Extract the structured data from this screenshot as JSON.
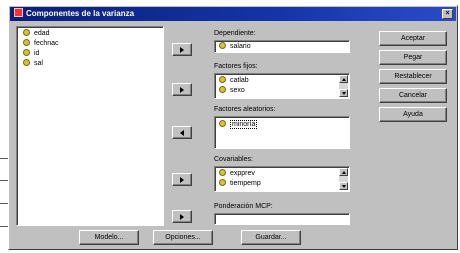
{
  "window": {
    "title": "Componentes de la varianza",
    "close_glyph": "×"
  },
  "source_list": {
    "items": [
      "edad",
      "fechnac",
      "id",
      "sal"
    ]
  },
  "dependiente": {
    "label": "Dependiente:",
    "value": "salario"
  },
  "factores_fijos": {
    "label": "Factores fijos:",
    "items": [
      "catlab",
      "sexo"
    ]
  },
  "factores_aleatorios": {
    "label": "Factores aleatorios:",
    "items": [
      "minoría"
    ]
  },
  "covariables": {
    "label": "Covariables:",
    "items": [
      "expprev",
      "tiempemp"
    ]
  },
  "ponderacion": {
    "label": "Ponderación MCP:",
    "value": ""
  },
  "side_buttons": [
    "Aceptar",
    "Pegar",
    "Restablecer",
    "Cancelar",
    "Ayuda"
  ],
  "bottom_buttons": [
    "Modelo...",
    "Opciones...",
    "Guardar..."
  ]
}
